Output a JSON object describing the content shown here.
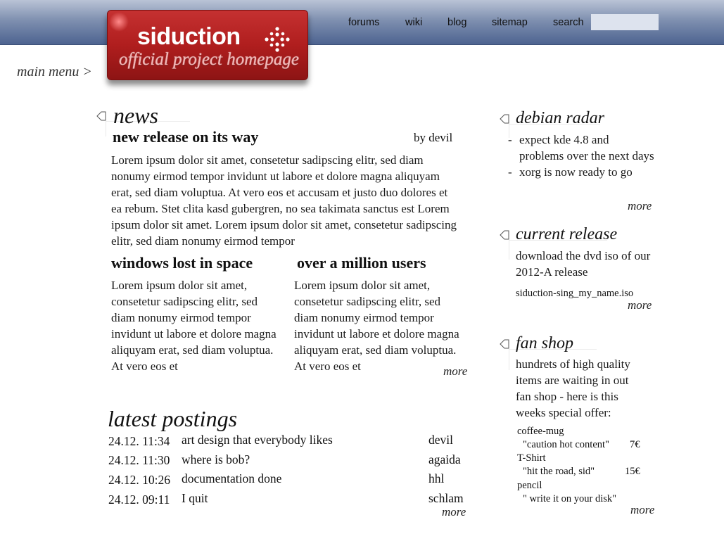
{
  "nav": {
    "items": [
      "forums",
      "wiki",
      "blog",
      "sitemap"
    ],
    "search_label": "search",
    "search_value": ""
  },
  "logo": {
    "name": "siduction",
    "tagline": "official project homepage"
  },
  "main_menu": "main menu >",
  "news": {
    "heading": "news",
    "lead": {
      "title": "new release on its way",
      "author": "by devil",
      "text": "Lorem ipsum dolor sit amet, consetetur sadipscing elitr, sed diam nonumy eirmod tempor invidunt ut labore et dolore magna aliquyam erat, sed diam voluptua. At vero eos et accusam et justo duo dolores et ea rebum. Stet clita kasd gubergren, no sea takimata sanctus est Lorem ipsum dolor sit amet. Lorem ipsum dolor sit amet, consetetur sadipscing elitr, sed diam nonumy eirmod tempor"
    },
    "articles": [
      {
        "title": "windows lost in space",
        "text": "Lorem ipsum dolor sit amet, consetetur sadipscing elitr, sed diam nonumy eirmod tempor invidunt ut labore et dolore magna aliquyam erat, sed diam voluptua. At vero eos et"
      },
      {
        "title": "over a million users",
        "text": "Lorem ipsum dolor sit amet, consetetur sadipscing elitr, sed diam nonumy eirmod tempor invidunt ut labore et dolore magna aliquyam erat, sed diam voluptua. At vero eos et"
      }
    ],
    "more": "more"
  },
  "latest_postings": {
    "heading": "latest postings",
    "rows": [
      {
        "time": "24.12. 11:34",
        "title": "art design that everybody likes",
        "user": "devil"
      },
      {
        "time": "24.12. 11:30",
        "title": "where is bob?",
        "user": "agaida"
      },
      {
        "time": "24.12. 10:26",
        "title": "documentation done",
        "user": "hhl"
      },
      {
        "time": "24.12. 09:11",
        "title": "I quit",
        "user": "schlam"
      }
    ],
    "more": "more"
  },
  "debian_radar": {
    "heading": "debian radar",
    "items": [
      "expect kde 4.8 and problems over the next days",
      "xorg is now ready to go"
    ],
    "more": "more"
  },
  "current_release": {
    "heading": "current release",
    "text": "download the dvd iso of our 2012-A release",
    "file": "siduction-sing_my_name.iso",
    "more": "more"
  },
  "fan_shop": {
    "heading": "fan shop",
    "text": "hundrets of high quality items are waiting in out fan shop - here is this weeks special offer:",
    "items": [
      {
        "name": "coffee-mug",
        "desc": "\"caution hot content\"",
        "price": "7€"
      },
      {
        "name": "T-Shirt",
        "desc": "\"hit the road, sid\"",
        "price": "15€"
      },
      {
        "name": "pencil",
        "desc": "\" write it on your disk\"",
        "price": ""
      }
    ],
    "more": "more"
  },
  "colors": {
    "topbar": "#5b6f98",
    "logo_red": "#b01e1e",
    "search_bg": "#dde3ee"
  }
}
